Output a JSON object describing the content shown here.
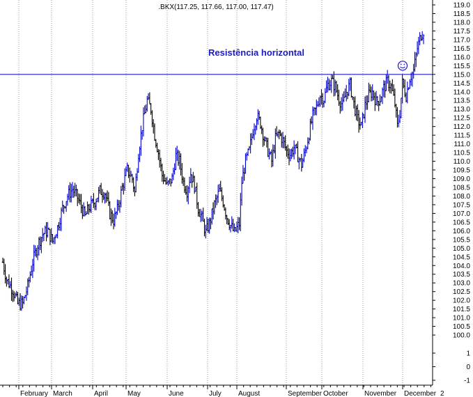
{
  "chart_data": {
    "type": "bar",
    "subtype": "ohlc",
    "title": ".BKX(117.25, 117.66, 117.00, 117.47)",
    "ylim": [
      -1,
      119
    ],
    "axis_break": {
      "from": 1.5,
      "to": 99.5
    },
    "y_ticks": [
      119.0,
      118.5,
      118.0,
      117.5,
      117.0,
      116.5,
      116.0,
      115.5,
      115.0,
      114.5,
      114.0,
      113.5,
      113.0,
      112.5,
      112.0,
      111.5,
      111.0,
      110.5,
      110.0,
      109.5,
      109.0,
      108.5,
      108.0,
      107.5,
      107.0,
      106.5,
      106.0,
      105.5,
      105.0,
      104.5,
      104.0,
      103.5,
      103.0,
      102.5,
      102.0,
      101.5,
      101.0,
      100.5,
      100.0,
      1,
      0,
      -1
    ],
    "y_tick_labels": [
      "119.0",
      "118.5",
      "118.0",
      "117.5",
      "117.0",
      "116.5",
      "116.0",
      "115.5",
      "115.0",
      "114.5",
      "114.0",
      "113.5",
      "113.0",
      "112.5",
      "112.0",
      "111.5",
      "111.0",
      "110.5",
      "110.0",
      "109.5",
      "109.0",
      "108.5",
      "108.0",
      "107.5",
      "107.0",
      "106.5",
      "106.0",
      "105.5",
      "105.0",
      "104.5",
      "104.0",
      "103.5",
      "103.0",
      "102.5",
      "102.0",
      "101.5",
      "101.0",
      "100.5",
      "100.0",
      "1",
      "0",
      "-1"
    ],
    "x_labels": [
      "February",
      "March",
      "April",
      "May",
      "June",
      "July",
      "August",
      "September",
      "October",
      "November",
      "December",
      "2"
    ],
    "grid": {
      "vertical": true,
      "horizontal": false,
      "style": "dotted"
    },
    "colors": {
      "up": "#0000cc",
      "down": "#000000",
      "annotation": "#1a1acc",
      "resistance": "#1a1acc"
    },
    "annotations": [
      {
        "text": "Resistência horizontal",
        "type": "hline",
        "value": 115.0
      },
      {
        "type": "smiley-icon",
        "value": 115.5
      }
    ],
    "anchors": [
      [
        0,
        104.2
      ],
      [
        3,
        103.2
      ],
      [
        8,
        102.6
      ],
      [
        12,
        101.8
      ],
      [
        16,
        101.8
      ],
      [
        20,
        102.8
      ],
      [
        24,
        104.2
      ],
      [
        28,
        105.2
      ],
      [
        32,
        105.8
      ],
      [
        36,
        106.0
      ],
      [
        40,
        105.4
      ],
      [
        44,
        106.2
      ],
      [
        48,
        107.3
      ],
      [
        52,
        108.0
      ],
      [
        56,
        108.4
      ],
      [
        60,
        107.9
      ],
      [
        64,
        107.2
      ],
      [
        66,
        106.8
      ],
      [
        69,
        107.3
      ],
      [
        74,
        107.7
      ],
      [
        78,
        108.3
      ],
      [
        82,
        108.2
      ],
      [
        86,
        107.0
      ],
      [
        89,
        106.6
      ],
      [
        92,
        107.2
      ],
      [
        96,
        108.5
      ],
      [
        100,
        109.5
      ],
      [
        104,
        109.0
      ],
      [
        106,
        108.2
      ],
      [
        109,
        110.5
      ],
      [
        112,
        112.0
      ],
      [
        116,
        113.5
      ],
      [
        119,
        113.0
      ],
      [
        122,
        111.5
      ],
      [
        125,
        110.5
      ],
      [
        128,
        109.2
      ],
      [
        132,
        108.6
      ],
      [
        136,
        109.0
      ],
      [
        139,
        110.3
      ],
      [
        142,
        110.0
      ],
      [
        145,
        108.8
      ],
      [
        148,
        108.3
      ],
      [
        151,
        109.3
      ],
      [
        154,
        108.6
      ],
      [
        157,
        107.3
      ],
      [
        160,
        106.7
      ],
      [
        163,
        105.9
      ],
      [
        166,
        106.4
      ],
      [
        170,
        107.5
      ],
      [
        174,
        108.3
      ],
      [
        177,
        107.7
      ],
      [
        180,
        106.8
      ],
      [
        183,
        106.3
      ],
      [
        186,
        105.9
      ],
      [
        190,
        106.4
      ],
      [
        192,
        108.8
      ],
      [
        195,
        110.0
      ],
      [
        198,
        110.6
      ],
      [
        201,
        111.8
      ],
      [
        204,
        112.6
      ],
      [
        207,
        112.2
      ],
      [
        210,
        111.3
      ],
      [
        213,
        110.6
      ],
      [
        216,
        110.0
      ],
      [
        219,
        111.3
      ],
      [
        222,
        111.6
      ],
      [
        225,
        111.2
      ],
      [
        228,
        110.6
      ],
      [
        231,
        110.4
      ],
      [
        234,
        110.8
      ],
      [
        237,
        110.3
      ],
      [
        240,
        109.8
      ],
      [
        243,
        110.6
      ],
      [
        246,
        111.6
      ],
      [
        249,
        112.6
      ],
      [
        252,
        113.1
      ],
      [
        255,
        113.8
      ],
      [
        258,
        113.6
      ],
      [
        261,
        114.4
      ],
      [
        264,
        114.6
      ],
      [
        267,
        114.3
      ],
      [
        270,
        113.6
      ],
      [
        273,
        113.2
      ],
      [
        276,
        114.0
      ],
      [
        279,
        114.4
      ],
      [
        282,
        113.3
      ],
      [
        285,
        112.4
      ],
      [
        288,
        112.0
      ],
      [
        291,
        113.2
      ],
      [
        294,
        113.8
      ],
      [
        297,
        114.0
      ],
      [
        300,
        113.4
      ],
      [
        303,
        113.6
      ],
      [
        306,
        114.2
      ],
      [
        309,
        114.6
      ],
      [
        312,
        114.3
      ],
      [
        315,
        113.3
      ],
      [
        317,
        112.0
      ],
      [
        319,
        112.8
      ],
      [
        321,
        114.5
      ],
      [
        324,
        113.8
      ],
      [
        327,
        114.8
      ],
      [
        330,
        115.2
      ],
      [
        333,
        116.5
      ],
      [
        336,
        117.3
      ],
      [
        338,
        117.5
      ]
    ]
  }
}
